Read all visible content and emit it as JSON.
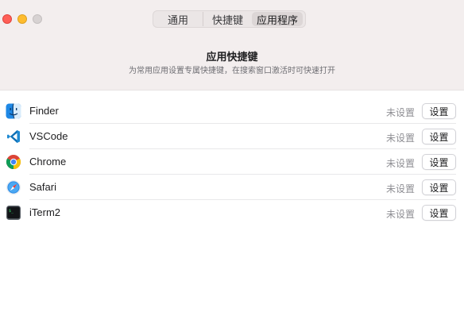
{
  "tabs": [
    {
      "label": "通用",
      "selected": false
    },
    {
      "label": "快捷键",
      "selected": false
    },
    {
      "label": "应用程序",
      "selected": true
    }
  ],
  "header": {
    "title": "应用快捷键",
    "subtitle": "为常用应用设置专属快捷键，在搜索窗口激活时可快速打开"
  },
  "apps": [
    {
      "name": "Finder",
      "icon": "finder-icon",
      "status": "未设置",
      "button": "设置"
    },
    {
      "name": "VSCode",
      "icon": "vscode-icon",
      "status": "未设置",
      "button": "设置"
    },
    {
      "name": "Chrome",
      "icon": "chrome-icon",
      "status": "未设置",
      "button": "设置"
    },
    {
      "name": "Safari",
      "icon": "safari-icon",
      "status": "未设置",
      "button": "设置"
    },
    {
      "name": "iTerm2",
      "icon": "iterm2-icon",
      "status": "未设置",
      "button": "设置"
    }
  ],
  "colors": {
    "close": "#ff5f57",
    "minimize": "#febc2e",
    "header_bg": "#f3eeee"
  }
}
